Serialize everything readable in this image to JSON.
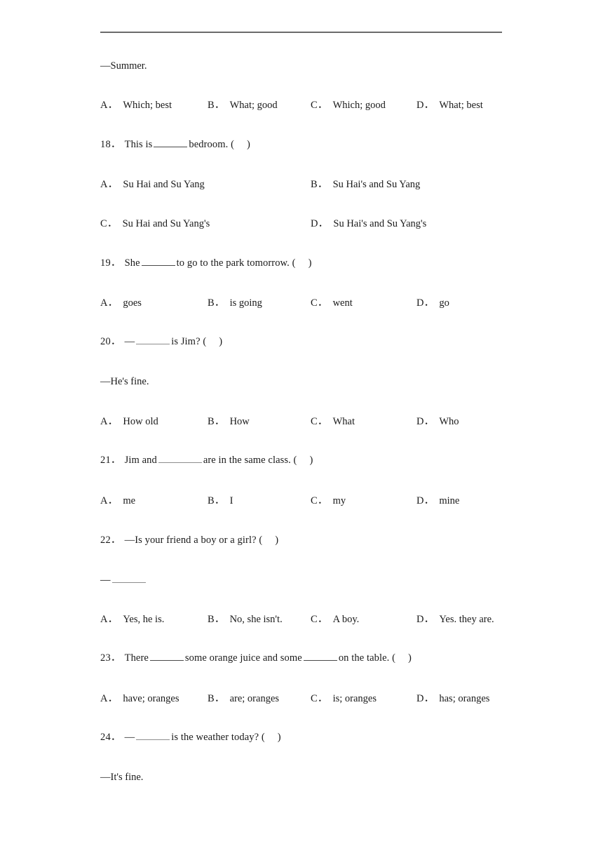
{
  "document": {
    "type": "english-exam-worksheet",
    "rule_color": "#6b6b6b",
    "text_color": "#1a1a1a"
  },
  "answer_lines": {
    "summer": "—Summer.",
    "hes_fine": "—He's fine.",
    "its_fine": "—It's fine.",
    "blank_dash": "—"
  },
  "questions": [
    {
      "id": "q17-options",
      "number": "",
      "stem_prefix": "",
      "options": [
        {
          "label": "A．",
          "text": "Which; best"
        },
        {
          "label": "B．",
          "text": "What; good"
        },
        {
          "label": "C．",
          "text": "Which; good"
        },
        {
          "label": "D．",
          "text": "What; best"
        }
      ]
    },
    {
      "id": "q18",
      "number": "18．",
      "stem_before": "This is",
      "stem_after": "bedroom. (",
      "stem_close": ")",
      "options": [
        {
          "label": "A．",
          "text": "Su Hai and Su Yang"
        },
        {
          "label": "B．",
          "text": "Su Hai's and Su Yang"
        },
        {
          "label": "C．",
          "text": "Su Hai and Su Yang's"
        },
        {
          "label": "D．",
          "text": "Su Hai's and Su Yang's"
        }
      ]
    },
    {
      "id": "q19",
      "number": "19．",
      "stem_before": "She",
      "stem_after": "to go to the park tomorrow. (",
      "stem_close": ")",
      "options": [
        {
          "label": "A．",
          "text": "goes"
        },
        {
          "label": "B．",
          "text": "is going"
        },
        {
          "label": "C．",
          "text": "went"
        },
        {
          "label": "D．",
          "text": "go"
        }
      ]
    },
    {
      "id": "q20",
      "number": "20．",
      "stem_before": "—",
      "stem_after": "is Jim? (",
      "stem_close": ")",
      "options": [
        {
          "label": "A．",
          "text": "How old"
        },
        {
          "label": "B．",
          "text": "How"
        },
        {
          "label": "C．",
          "text": "What"
        },
        {
          "label": "D．",
          "text": "Who"
        }
      ]
    },
    {
      "id": "q21",
      "number": "21．",
      "stem_before": "Jim and",
      "stem_after": "are in the same class. (",
      "stem_close": ")",
      "options": [
        {
          "label": "A．",
          "text": "me"
        },
        {
          "label": "B．",
          "text": "I"
        },
        {
          "label": "C．",
          "text": "my"
        },
        {
          "label": "D．",
          "text": "mine"
        }
      ]
    },
    {
      "id": "q22",
      "number": "22．",
      "stem_before": "—Is your friend a boy or a girl? (",
      "stem_after": "",
      "stem_close": ")",
      "options": [
        {
          "label": "A．",
          "text": "Yes, he is."
        },
        {
          "label": "B．",
          "text": "No, she isn't."
        },
        {
          "label": "C．",
          "text": "A boy."
        },
        {
          "label": "D．",
          "text": "Yes. they are."
        }
      ]
    },
    {
      "id": "q23",
      "number": "23．",
      "stem_before": "There",
      "stem_mid": "some orange juice and some",
      "stem_after": "on the table. (",
      "stem_close": ")",
      "options": [
        {
          "label": "A．",
          "text": "have; oranges"
        },
        {
          "label": "B．",
          "text": "are; oranges"
        },
        {
          "label": "C．",
          "text": "is; oranges"
        },
        {
          "label": "D．",
          "text": "has; oranges"
        }
      ]
    },
    {
      "id": "q24",
      "number": "24．",
      "stem_before": "—",
      "stem_after": "is the weather today? (",
      "stem_close": ")",
      "options": []
    }
  ]
}
